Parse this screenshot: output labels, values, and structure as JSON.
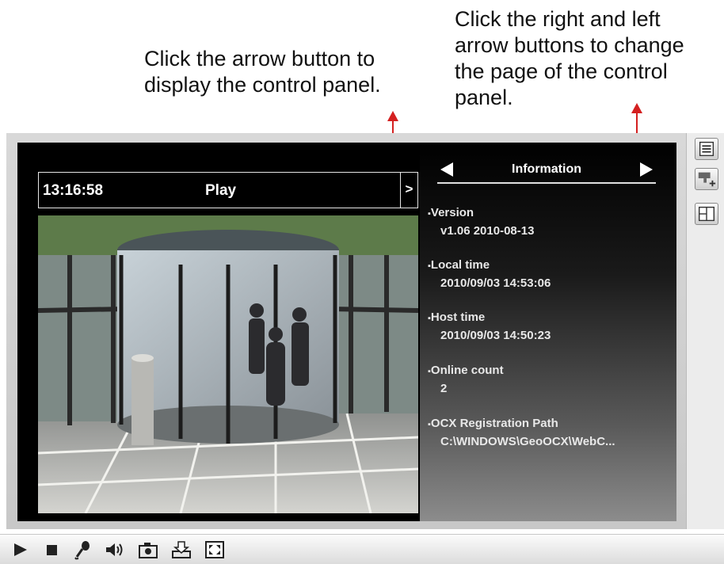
{
  "annotations": {
    "left_lines": [
      "Click the arrow button to",
      "display the control panel."
    ],
    "right_lines": [
      "Click the right and left",
      "arrow buttons to change",
      "the page of the control",
      "panel."
    ],
    "arrow_color": "#d42020"
  },
  "video": {
    "time": "13:16:58",
    "status": "Play",
    "panel_toggle_glyph": ">"
  },
  "info": {
    "title": "Information",
    "items": [
      {
        "label": "Version",
        "value": "v1.06  2010-08-13"
      },
      {
        "label": "Local time",
        "value": "2010/09/03 14:53:06"
      },
      {
        "label": "Host time",
        "value": "2010/09/03 14:50:23"
      },
      {
        "label": "Online count",
        "value": "2"
      },
      {
        "label": "OCX Registration Path",
        "value": "C:\\WINDOWS\\GeoOCX\\WebC..."
      }
    ]
  },
  "bottom_toolbar": {
    "icons": [
      "play-icon",
      "stop-icon",
      "microphone-icon",
      "speaker-icon",
      "snapshot-icon",
      "save-icon",
      "fullscreen-icon"
    ]
  },
  "side_toolbar": {
    "icons": [
      "list-icon",
      "ptz-icon",
      "layout-icon"
    ]
  }
}
